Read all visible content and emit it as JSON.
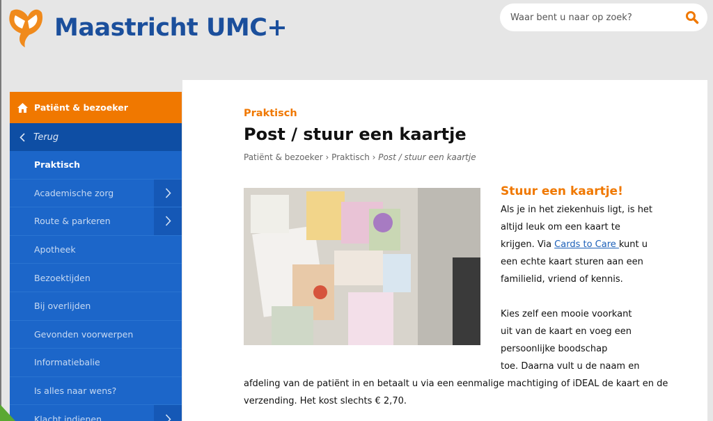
{
  "header": {
    "brand": "Maastricht UMC+",
    "search_placeholder": "Waar bent u naar op zoek?"
  },
  "sidebar": {
    "section": "Patiënt & bezoeker",
    "back": "Terug",
    "items": [
      {
        "label": "Praktisch",
        "active": true,
        "has_sub": false
      },
      {
        "label": "Academische zorg",
        "active": false,
        "has_sub": true
      },
      {
        "label": "Route & parkeren",
        "active": false,
        "has_sub": true
      },
      {
        "label": "Apotheek",
        "active": false,
        "has_sub": false
      },
      {
        "label": "Bezoektijden",
        "active": false,
        "has_sub": false
      },
      {
        "label": "Bij overlijden",
        "active": false,
        "has_sub": false
      },
      {
        "label": "Gevonden voorwerpen",
        "active": false,
        "has_sub": false
      },
      {
        "label": "Informatiebalie",
        "active": false,
        "has_sub": false
      },
      {
        "label": "Is alles naar wens?",
        "active": false,
        "has_sub": false
      },
      {
        "label": "Klacht indienen",
        "active": false,
        "has_sub": true
      }
    ]
  },
  "content": {
    "kicker": "Praktisch",
    "title": "Post / stuur een kaartje",
    "breadcrumb": {
      "level1": "Patiënt & bezoeker",
      "sep": " › ",
      "level2": "Praktisch",
      "current": "Post / stuur een kaartje"
    },
    "heading": "Stuur een kaartje!",
    "p1_lines": [
      "Als je in het ziekenhuis ligt, is het",
      "altijd leuk om een kaart te"
    ],
    "p1_pre": "krijgen. Via ",
    "p1_link": "Cards to Care ",
    "p1_post": "kunt u",
    "p1_tail": [
      "een echte kaart sturen aan een",
      "familielid, vriend of kennis."
    ],
    "p2_lines": [
      "Kies zelf een mooie voorkant",
      "uit van de kaart en voeg een",
      "persoonlijke boodschap",
      "toe. Daarna vult u de naam en"
    ],
    "p2_full": [
      "afdeling van de patiënt in en betaalt u via een eenmalige machtiging of iDEAL de kaart en de",
      "verzending. Het kost slechts € 2,70."
    ]
  },
  "colors": {
    "orange": "#f07800",
    "blue": "#1c66c9",
    "dark_blue": "#0e4ea4",
    "brand_blue": "#1b4f9c"
  }
}
